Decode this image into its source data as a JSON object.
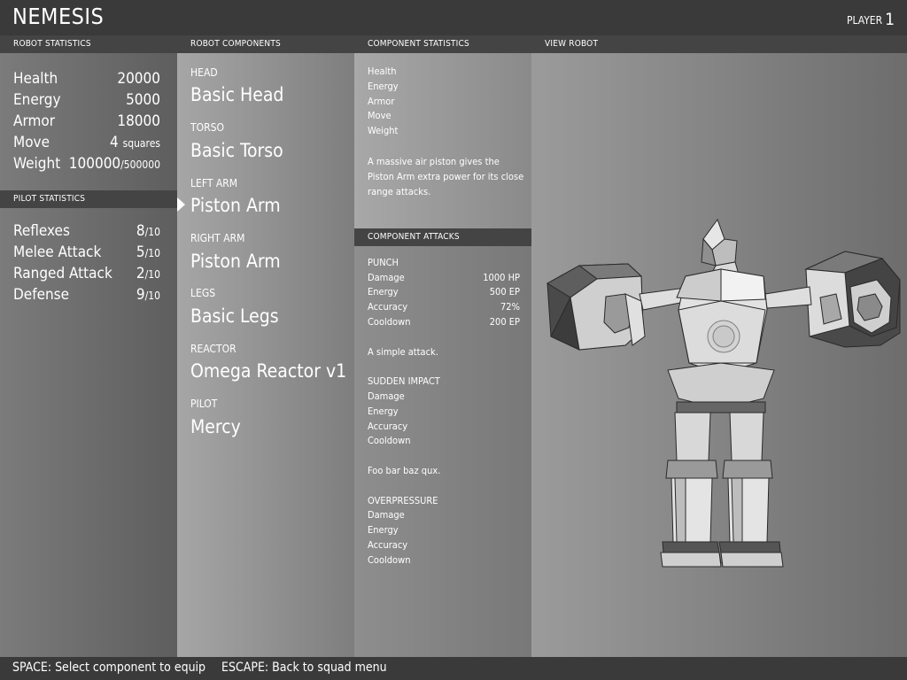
{
  "app": {
    "title": "NEMESIS",
    "player_label": "PLAYER",
    "player_number": "1"
  },
  "robot_stats": {
    "header": "ROBOT STATISTICS",
    "rows": [
      {
        "label": "Health",
        "value": "20000",
        "unit": ""
      },
      {
        "label": "Energy",
        "value": "5000",
        "unit": ""
      },
      {
        "label": "Armor",
        "value": "18000",
        "unit": ""
      },
      {
        "label": "Move",
        "value": "4 ",
        "unit": "squares"
      },
      {
        "label": "Weight",
        "value": "100000",
        "unit": "/500000"
      }
    ]
  },
  "pilot_stats": {
    "header": "PILOT STATISTICS",
    "rows": [
      {
        "label": "Reflexes",
        "value": "8",
        "unit": "/10"
      },
      {
        "label": "Melee Attack",
        "value": "5",
        "unit": "/10"
      },
      {
        "label": "Ranged Attack",
        "value": "2",
        "unit": "/10"
      },
      {
        "label": "Defense",
        "value": "9",
        "unit": "/10"
      }
    ]
  },
  "components": {
    "header": "ROBOT COMPONENTS",
    "selected_index": 2,
    "items": [
      {
        "category": "HEAD",
        "name": "Basic Head"
      },
      {
        "category": "TORSO",
        "name": "Basic Torso"
      },
      {
        "category": "LEFT ARM",
        "name": "Piston Arm"
      },
      {
        "category": "RIGHT ARM",
        "name": "Piston Arm"
      },
      {
        "category": "LEGS",
        "name": "Basic Legs"
      },
      {
        "category": "REACTOR",
        "name": "Omega Reactor v1"
      },
      {
        "category": "PILOT",
        "name": "Mercy"
      }
    ]
  },
  "component_stats": {
    "header": "COMPONENT STATISTICS",
    "labels": [
      "Health",
      "Energy",
      "Armor",
      "Move",
      "Weight"
    ],
    "description": "A massive air piston gives the Piston Arm extra power for its close range attacks."
  },
  "component_attacks": {
    "header": "COMPONENT ATTACKS",
    "attacks": [
      {
        "name": "PUNCH",
        "stats": [
          {
            "label": "Damage",
            "value": "1000 HP"
          },
          {
            "label": "Energy",
            "value": "500 EP"
          },
          {
            "label": "Accuracy",
            "value": "72%"
          },
          {
            "label": "Cooldown",
            "value": "200 EP"
          }
        ],
        "description": "A simple attack."
      },
      {
        "name": "SUDDEN IMPACT",
        "stats": [
          {
            "label": "Damage",
            "value": ""
          },
          {
            "label": "Energy",
            "value": ""
          },
          {
            "label": "Accuracy",
            "value": ""
          },
          {
            "label": "Cooldown",
            "value": ""
          }
        ],
        "description": "Foo bar baz qux."
      },
      {
        "name": "OVERPRESSURE",
        "stats": [
          {
            "label": "Damage",
            "value": ""
          },
          {
            "label": "Energy",
            "value": ""
          },
          {
            "label": "Accuracy",
            "value": ""
          },
          {
            "label": "Cooldown",
            "value": ""
          }
        ],
        "description": ""
      }
    ]
  },
  "view_robot": {
    "header": "VIEW ROBOT"
  },
  "footer": {
    "space_hint": "SPACE: Select component to equip",
    "escape_hint": "ESCAPE: Back to squad menu"
  },
  "colors": {
    "panel_header": "#444444",
    "bar": "#3a3a3a",
    "text": "#ffffff"
  }
}
